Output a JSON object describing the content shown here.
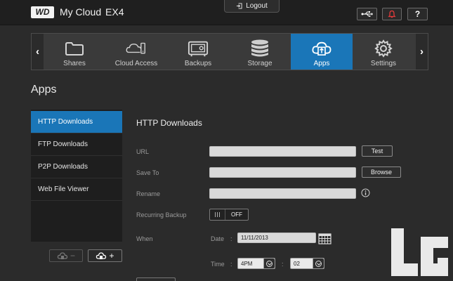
{
  "header": {
    "logo_text": "WD",
    "app_name": "My Cloud",
    "model": "EX4",
    "logout_label": "Logout",
    "help_label": "?"
  },
  "nav": {
    "items": [
      {
        "label": "Shares",
        "icon": "folder-icon"
      },
      {
        "label": "Cloud Access",
        "icon": "cloud-icon"
      },
      {
        "label": "Backups",
        "icon": "safe-icon"
      },
      {
        "label": "Storage",
        "icon": "database-icon"
      },
      {
        "label": "Apps",
        "icon": "apps-icon",
        "active": true
      },
      {
        "label": "Settings",
        "icon": "gear-icon"
      }
    ],
    "prev": "‹",
    "next": "›"
  },
  "page_title": "Apps",
  "sidebar": {
    "items": [
      {
        "label": "HTTP Downloads",
        "active": true
      },
      {
        "label": "FTP Downloads"
      },
      {
        "label": "P2P Downloads"
      },
      {
        "label": "Web File Viewer"
      }
    ],
    "remove_label": "−",
    "add_label": "+"
  },
  "form": {
    "title": "HTTP Downloads",
    "url_label": "URL",
    "url_value": "",
    "test_label": "Test",
    "save_to_label": "Save To",
    "save_to_value": "",
    "browse_label": "Browse",
    "rename_label": "Rename",
    "rename_value": "",
    "recurring_label": "Recurring Backup",
    "recurring_state": "OFF",
    "when_label": "When",
    "date_label": "Date",
    "date_value": "11/11/2013",
    "time_label": "Time",
    "hour_value": "4PM",
    "minute_value": "02",
    "colon": ":"
  },
  "colors": {
    "accent": "#1a76b8",
    "alert": "#e03a3a",
    "background": "#2b2b2b"
  }
}
